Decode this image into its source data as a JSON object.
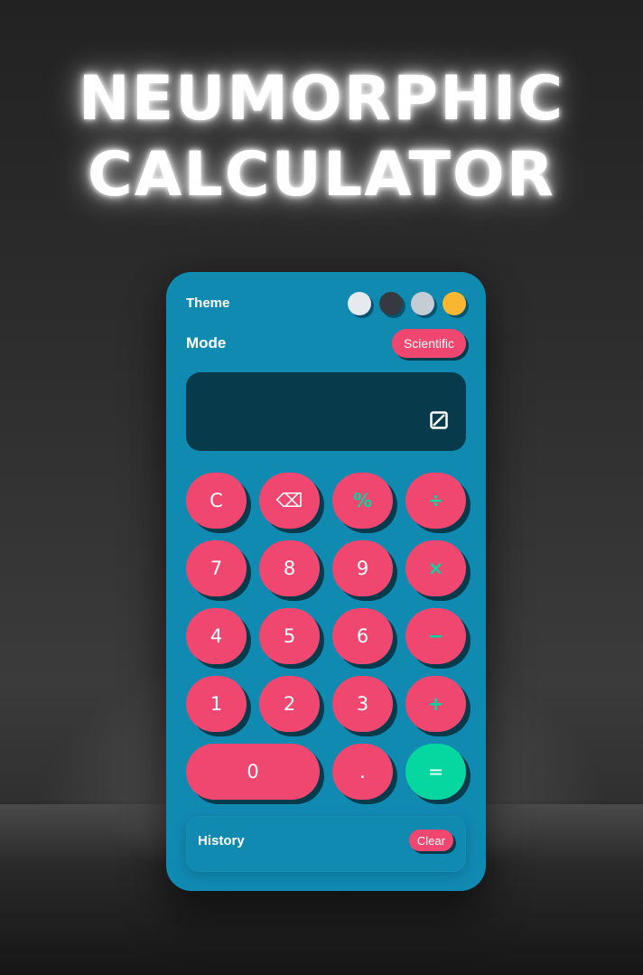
{
  "title": {
    "line1": "NEUMORPHIC",
    "line2": "CALCULATOR"
  },
  "colors": {
    "body": "#118ab2",
    "display": "#073b4c",
    "key": "#ef476f",
    "operator_text": "#06d6a0",
    "equals": "#06d6a0",
    "key_shadow": "#073b4c"
  },
  "theme": {
    "label": "Theme",
    "swatches": [
      {
        "name": "light",
        "color": "#e6e9ee"
      },
      {
        "name": "dark",
        "color": "#353a40"
      },
      {
        "name": "silver",
        "color": "#c6ccd4"
      },
      {
        "name": "yellow",
        "color": "#f7b731"
      }
    ]
  },
  "mode": {
    "label": "Mode",
    "button_label": "Scientific"
  },
  "display": {
    "value": "",
    "icon": "toggle-icon"
  },
  "keys": {
    "clear": "C",
    "backspace": "⌫",
    "percent": "%",
    "divide": "÷",
    "seven": "7",
    "eight": "8",
    "nine": "9",
    "multiply": "×",
    "four": "4",
    "five": "5",
    "six": "6",
    "minus": "−",
    "one": "1",
    "two": "2",
    "three": "3",
    "plus": "+",
    "zero": "0",
    "dot": ".",
    "equals": "="
  },
  "history": {
    "label": "History",
    "clear_label": "Clear"
  }
}
